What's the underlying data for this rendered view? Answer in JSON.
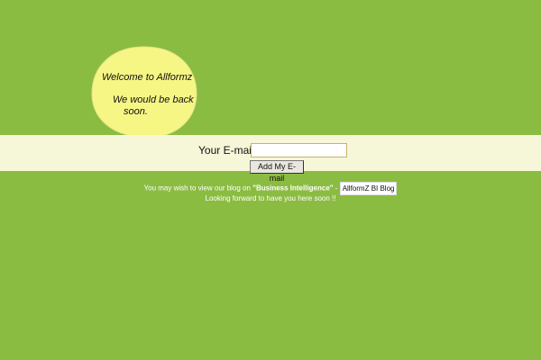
{
  "colors": {
    "background": "#8bbc42",
    "band": "#f6f7d9",
    "bubble_fill": "#f6f685",
    "footer_text": "#ffffff"
  },
  "bubble": {
    "line1": "Welcome to Allformz",
    "line2": "We would be back",
    "line3": "soon."
  },
  "form": {
    "email_label": "Your E-mail:",
    "email_value": "",
    "submit_label": "Add My E-mail"
  },
  "footer": {
    "line1_prefix": "You may wish to view our blog on ",
    "line1_bold": "\"Business Intelligence\"",
    "line1_sep": " - ",
    "blog_link": "AllformZ BI Blog",
    "line2": "Looking forward to have you here soon !!"
  }
}
